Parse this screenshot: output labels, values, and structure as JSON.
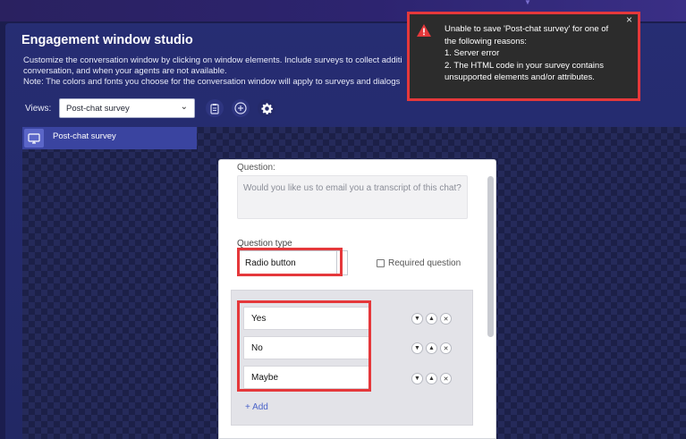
{
  "header": {
    "title": "Engagement window studio",
    "description_line1": "Customize the conversation window by clicking on window elements. Include surveys to collect additi",
    "description_line2": "conversation, and when your agents are not available.",
    "description_line3": "Note: The colors and fonts you choose for the conversation window will apply to surveys and dialogs"
  },
  "toolbar": {
    "views_label": "Views:",
    "views_selected": "Post-chat survey",
    "icons": [
      "clipboard-icon",
      "add-icon",
      "gear-icon"
    ]
  },
  "tab": {
    "label": "Post-chat survey",
    "icon": "monitor-icon"
  },
  "question": {
    "label": "Question:",
    "placeholder": "Would you like us to email you a transcript of this chat?",
    "type_label": "Question type",
    "type_value": "Radio button",
    "required_label": "Required question"
  },
  "options": {
    "items": [
      {
        "label": "Yes"
      },
      {
        "label": "No"
      },
      {
        "label": "Maybe"
      }
    ],
    "add_label": "+ Add"
  },
  "toast": {
    "line1": "Unable to save 'Post-chat survey' for one of",
    "line2": "the following reasons:",
    "line3": "1. Server error",
    "line4": "2. The HTML code in your survey contains",
    "line5": "unsupported elements and/or attributes.",
    "close": "×"
  },
  "colors": {
    "highlight": "#e5383b",
    "accent": "#4a63c8",
    "background": "#1b1d4e"
  }
}
